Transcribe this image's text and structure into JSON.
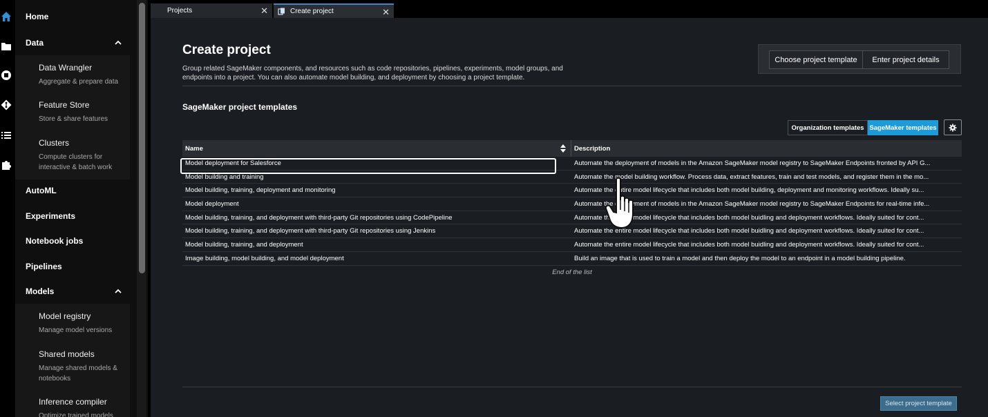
{
  "sidebar": {
    "home": "Home",
    "data": "Data",
    "data_items": [
      {
        "title": "Data Wrangler",
        "desc": "Aggregate & prepare data"
      },
      {
        "title": "Feature Store",
        "desc": "Store & share features"
      },
      {
        "title": "Clusters",
        "desc": "Compute clusters for interactive & batch work"
      }
    ],
    "automl": "AutoML",
    "experiments": "Experiments",
    "notebook_jobs": "Notebook jobs",
    "pipelines": "Pipelines",
    "models": "Models",
    "model_items": [
      {
        "title": "Model registry",
        "desc": "Manage model versions"
      },
      {
        "title": "Shared models",
        "desc": "Manage shared models & notebooks"
      },
      {
        "title": "Inference compiler",
        "desc": "Optimize trained models"
      }
    ]
  },
  "tabs": [
    {
      "label": "Projects"
    },
    {
      "label": "Create project"
    }
  ],
  "page": {
    "title": "Create project",
    "subtitle": "Group related SageMaker components, and resources such as code repositories, pipelines, experiments, model groups, and endpoints into a project. You can also automate model building, and deployment by choosing a project template.",
    "steps": [
      "Choose project template",
      "Enter project details"
    ],
    "section_title": "SageMaker project templates",
    "seg_org": "Organization templates",
    "seg_sm": "SageMaker templates",
    "col_name": "Name",
    "col_desc": "Description",
    "end_of_list": "End of the list",
    "select_button": "Select project template"
  },
  "rows": [
    {
      "name": "Model deployment for Salesforce",
      "desc": "Automate the deployment of models in the Amazon SageMaker model registry to SageMaker Endpoints fronted by API G..."
    },
    {
      "name": "Model building and training",
      "desc": "Automate the model building workflow. Process data, extract features, train and test models, and register them in the mo..."
    },
    {
      "name": "Model building, training, deployment and monitoring",
      "desc": "Automate the entire model lifecycle that includes both model building, deployment and monitoring workflows. Ideally su..."
    },
    {
      "name": "Model deployment",
      "desc": "Automate the deployment of models in the Amazon SageMaker model registry to SageMaker Endpoints for real-time infe..."
    },
    {
      "name": "Model building, training, and deployment with third-party Git repositories using CodePipeline",
      "desc": "Automate the entire model lifecycle that includes both model buidling and deployment workflows. Ideally suited for cont..."
    },
    {
      "name": "Model building, training, and deployment with third-party Git repositories using Jenkins",
      "desc": "Automate the entire model lifecycle that includes both model buidling and deployment workflows. Ideally suited for cont..."
    },
    {
      "name": "Model building, training, and deployment",
      "desc": "Automate the entire model lifecycle that includes both model buidling and deployment workflows. Ideally suited for cont..."
    },
    {
      "name": "Image building, model building, and model deployment",
      "desc": "Build an image that is used to train a model and then deploy the model to an endpoint in a model building pipeline."
    }
  ],
  "colors": {
    "accent": "#1d9bd8",
    "primary_button": "#3c6d8c"
  }
}
